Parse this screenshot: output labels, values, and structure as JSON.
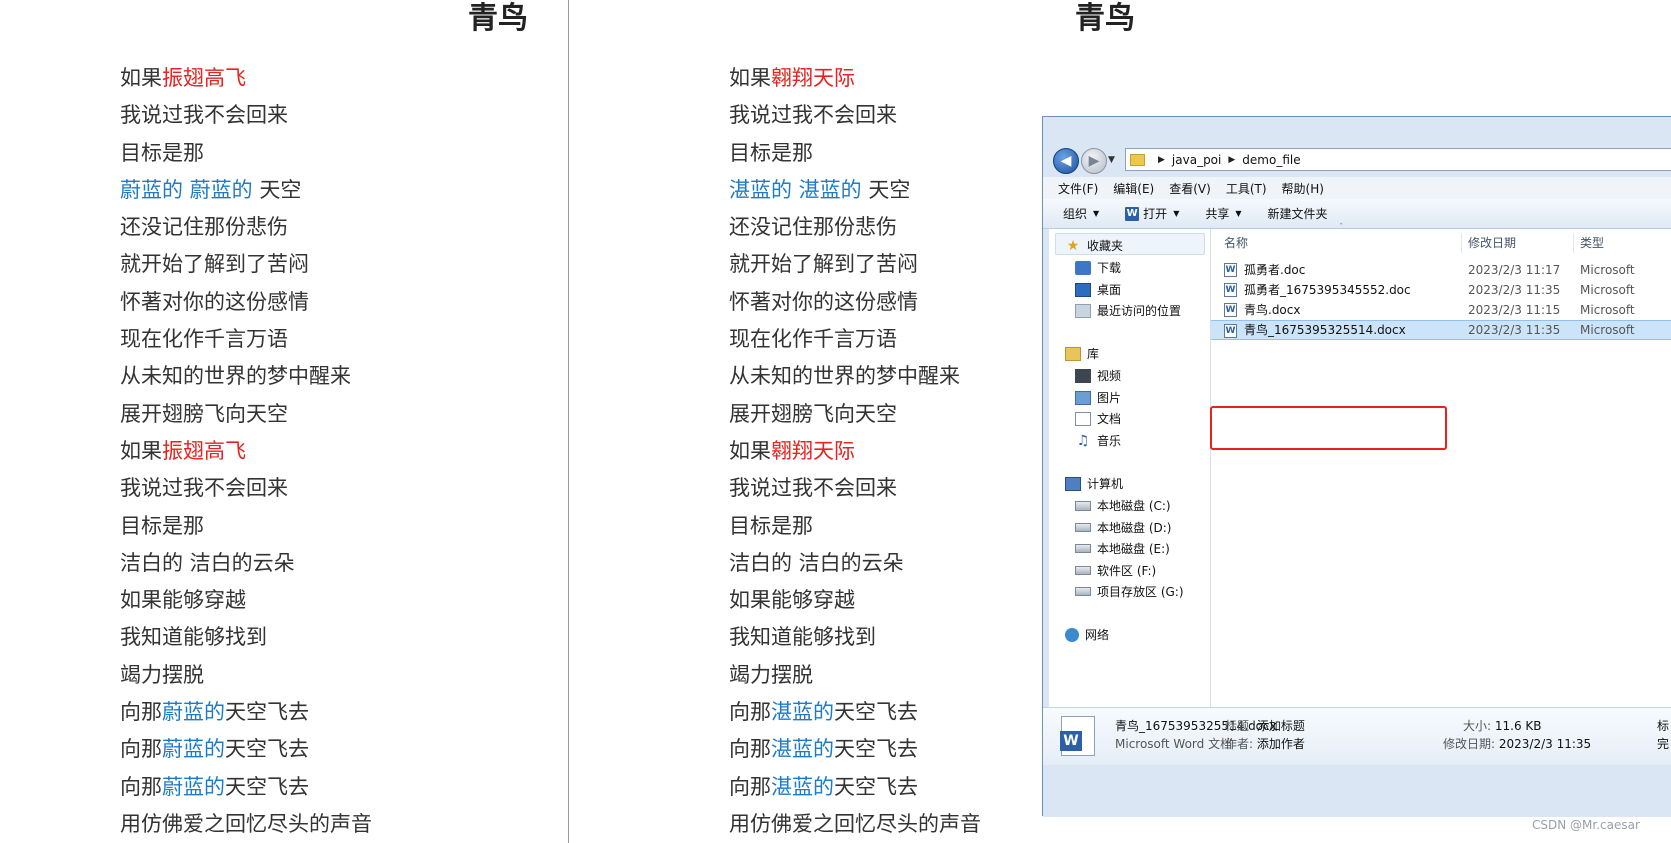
{
  "doc_left": {
    "title": "青鸟",
    "lines": [
      {
        "segments": [
          {
            "text": "如果",
            "color": "dark"
          },
          {
            "text": "振翅高飞",
            "color": "red"
          }
        ]
      },
      {
        "segments": [
          {
            "text": "我说过我不会回来",
            "color": "dark"
          }
        ]
      },
      {
        "segments": [
          {
            "text": "目标是那",
            "color": "dark"
          }
        ]
      },
      {
        "segments": [
          {
            "text": "蔚蓝的 蔚蓝的",
            "color": "blue"
          },
          {
            "text": " 天空",
            "color": "dark"
          }
        ]
      },
      {
        "segments": [
          {
            "text": "还没记住那份悲伤",
            "color": "dark"
          }
        ]
      },
      {
        "segments": [
          {
            "text": "就开始了解到了苦闷",
            "color": "dark"
          }
        ]
      },
      {
        "segments": [
          {
            "text": "怀著对你的这份感情",
            "color": "dark"
          }
        ]
      },
      {
        "segments": [
          {
            "text": "现在化作千言万语",
            "color": "dark"
          }
        ]
      },
      {
        "segments": [
          {
            "text": "从未知的世界的梦中醒来",
            "color": "dark"
          }
        ]
      },
      {
        "segments": [
          {
            "text": "展开翅膀飞向天空",
            "color": "dark"
          }
        ]
      },
      {
        "segments": [
          {
            "text": "如果",
            "color": "dark"
          },
          {
            "text": "振翅高飞",
            "color": "red"
          }
        ]
      },
      {
        "segments": [
          {
            "text": "我说过我不会回来",
            "color": "dark"
          }
        ]
      },
      {
        "segments": [
          {
            "text": "目标是那",
            "color": "dark"
          }
        ]
      },
      {
        "segments": [
          {
            "text": "洁白的 洁白的云朵",
            "color": "dark"
          }
        ]
      },
      {
        "segments": [
          {
            "text": "如果能够穿越",
            "color": "dark"
          }
        ]
      },
      {
        "segments": [
          {
            "text": "我知道能够找到",
            "color": "dark"
          }
        ]
      },
      {
        "segments": [
          {
            "text": "竭力摆脱",
            "color": "dark"
          }
        ]
      },
      {
        "segments": [
          {
            "text": "向那",
            "color": "dark"
          },
          {
            "text": "蔚蓝的",
            "color": "blue"
          },
          {
            "text": "天空飞去",
            "color": "dark"
          }
        ]
      },
      {
        "segments": [
          {
            "text": "向那",
            "color": "dark"
          },
          {
            "text": "蔚蓝的",
            "color": "blue"
          },
          {
            "text": "天空飞去",
            "color": "dark"
          }
        ]
      },
      {
        "segments": [
          {
            "text": "向那",
            "color": "dark"
          },
          {
            "text": "蔚蓝的",
            "color": "blue"
          },
          {
            "text": "天空飞去",
            "color": "dark"
          }
        ]
      },
      {
        "segments": [
          {
            "text": "用仿佛爱之回忆尽头的声音",
            "color": "dark"
          }
        ]
      }
    ]
  },
  "doc_right": {
    "title": "青鸟",
    "lines": [
      {
        "segments": [
          {
            "text": "如果",
            "color": "dark"
          },
          {
            "text": "翱翔天际",
            "color": "red"
          }
        ]
      },
      {
        "segments": [
          {
            "text": "我说过我不会回来",
            "color": "dark"
          }
        ]
      },
      {
        "segments": [
          {
            "text": "目标是那",
            "color": "dark"
          }
        ]
      },
      {
        "segments": [
          {
            "text": "湛蓝的 湛蓝的",
            "color": "blue"
          },
          {
            "text": " 天空",
            "color": "dark"
          }
        ]
      },
      {
        "segments": [
          {
            "text": "还没记住那份悲伤",
            "color": "dark"
          }
        ]
      },
      {
        "segments": [
          {
            "text": "就开始了解到了苦闷",
            "color": "dark"
          }
        ]
      },
      {
        "segments": [
          {
            "text": "怀著对你的这份感情",
            "color": "dark"
          }
        ]
      },
      {
        "segments": [
          {
            "text": "现在化作千言万语",
            "color": "dark"
          }
        ]
      },
      {
        "segments": [
          {
            "text": "从未知的世界的梦中醒来",
            "color": "dark"
          }
        ]
      },
      {
        "segments": [
          {
            "text": "展开翅膀飞向天空",
            "color": "dark"
          }
        ]
      },
      {
        "segments": [
          {
            "text": "如果",
            "color": "dark"
          },
          {
            "text": "翱翔天际",
            "color": "red"
          }
        ]
      },
      {
        "segments": [
          {
            "text": "我说过我不会回来",
            "color": "dark"
          }
        ]
      },
      {
        "segments": [
          {
            "text": "目标是那",
            "color": "dark"
          }
        ]
      },
      {
        "segments": [
          {
            "text": "洁白的 洁白的云朵",
            "color": "dark"
          }
        ]
      },
      {
        "segments": [
          {
            "text": "如果能够穿越",
            "color": "dark"
          }
        ]
      },
      {
        "segments": [
          {
            "text": "我知道能够找到",
            "color": "dark"
          }
        ]
      },
      {
        "segments": [
          {
            "text": "竭力摆脱",
            "color": "dark"
          }
        ]
      },
      {
        "segments": [
          {
            "text": "向那",
            "color": "dark"
          },
          {
            "text": "湛蓝的",
            "color": "blue"
          },
          {
            "text": "天空飞去",
            "color": "dark"
          }
        ]
      },
      {
        "segments": [
          {
            "text": "向那",
            "color": "dark"
          },
          {
            "text": "湛蓝的",
            "color": "blue"
          },
          {
            "text": "天空飞去",
            "color": "dark"
          }
        ]
      },
      {
        "segments": [
          {
            "text": "向那",
            "color": "dark"
          },
          {
            "text": "湛蓝的",
            "color": "blue"
          },
          {
            "text": "天空飞去",
            "color": "dark"
          }
        ]
      },
      {
        "segments": [
          {
            "text": "用仿佛爱之回忆尽头的声音",
            "color": "dark"
          }
        ]
      }
    ]
  },
  "colors": {
    "red": "#e8231f",
    "blue": "#1d7bc7",
    "dark": "#333333"
  },
  "explorer": {
    "breadcrumb": [
      "java_poi",
      "demo_file"
    ],
    "menu": [
      "文件(F)",
      "编辑(E)",
      "查看(V)",
      "工具(T)",
      "帮助(H)"
    ],
    "toolbar": {
      "organize": "组织",
      "open": "打开",
      "share": "共享",
      "new_folder": "新建文件夹"
    },
    "nav": {
      "favorites": "收藏夹",
      "downloads": "下载",
      "desktop": "桌面",
      "recent": "最近访问的位置",
      "libraries": "库",
      "videos": "视频",
      "pictures": "图片",
      "documents": "文档",
      "music": "音乐",
      "computer": "计算机",
      "drive_c": "本地磁盘 (C:)",
      "drive_d": "本地磁盘 (D:)",
      "drive_e": "本地磁盘 (E:)",
      "drive_f": "软件区 (F:)",
      "drive_g": "项目存放区 (G:)",
      "network": "网络"
    },
    "columns": {
      "name": "名称",
      "date": "修改日期",
      "type": "类型"
    },
    "files": [
      {
        "name": "孤勇者.doc",
        "date": "2023/2/3 11:17",
        "type": "Microsoft"
      },
      {
        "name": "孤勇者_1675395345552.doc",
        "date": "2023/2/3 11:35",
        "type": "Microsoft"
      },
      {
        "name": "青鸟.docx",
        "date": "2023/2/3 11:15",
        "type": "Microsoft"
      },
      {
        "name": "青鸟_1675395325514.docx",
        "date": "2023/2/3 11:35",
        "type": "Microsoft"
      }
    ],
    "selected_index": 3,
    "details": {
      "file_name": "青鸟_1675395325514.docx",
      "file_type": "Microsoft Word 文档",
      "title_label": "标题:",
      "title_value": "添加标题",
      "author_label": "作者:",
      "author_value": "添加作者",
      "size_label": "大小:",
      "size_value": "11.6 KB",
      "modified_label": "修改日期:",
      "modified_value": "2023/2/3 11:35",
      "extra1": "标",
      "extra2": "完"
    }
  },
  "watermark": "CSDN @Mr.caesar"
}
